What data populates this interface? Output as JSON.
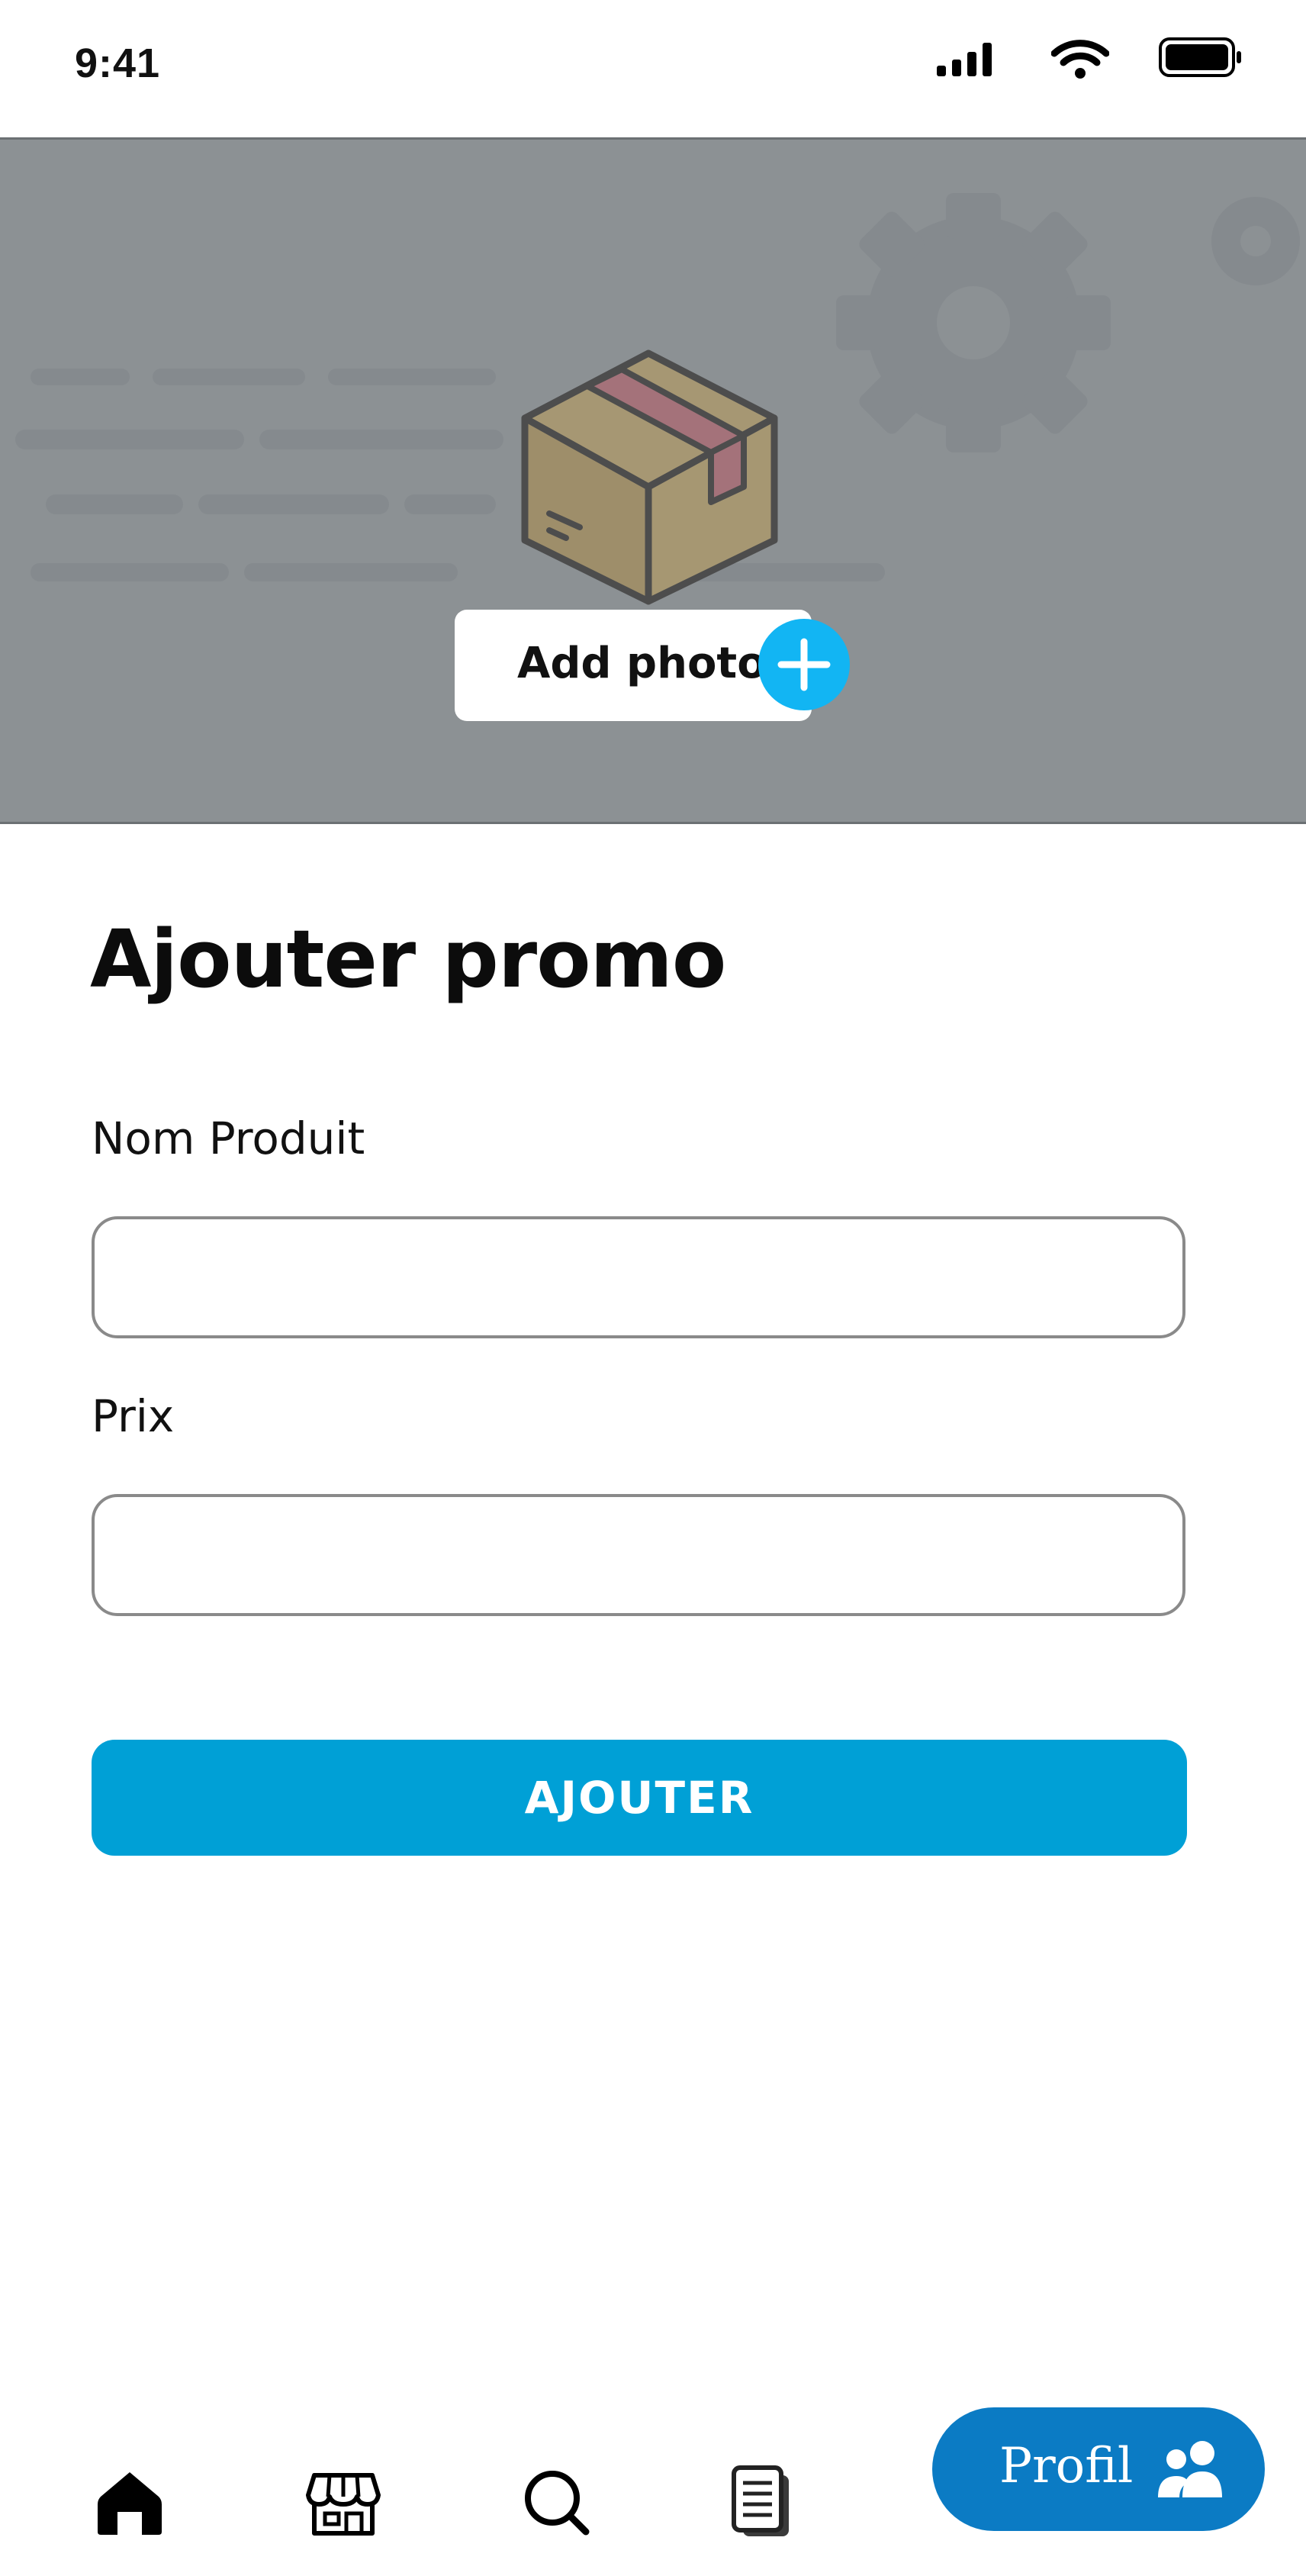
{
  "status_bar": {
    "time": "9:41",
    "icons": [
      "signal-icon",
      "wifi-icon",
      "battery-icon"
    ]
  },
  "hero": {
    "illustration": "package-box-icon",
    "add_photo_label": "Add photo",
    "add_icon": "plus-icon"
  },
  "form": {
    "title": "Ajouter promo",
    "fields": [
      {
        "label": "Nom Produit",
        "value": "",
        "placeholder": ""
      },
      {
        "label": "Prix",
        "value": "",
        "placeholder": ""
      }
    ],
    "submit_label": "AJOUTER"
  },
  "bottom_nav": {
    "items": [
      {
        "icon": "home-icon",
        "active": true
      },
      {
        "icon": "store-icon",
        "active": false
      },
      {
        "icon": "search-icon",
        "active": false
      },
      {
        "icon": "documents-icon",
        "active": false
      }
    ],
    "profile": {
      "label": "Profil",
      "icon": "users-icon"
    }
  },
  "colors": {
    "accent": "#00a0d6",
    "plus_button": "#12b5f3",
    "profile_pill": "#0b7bc4",
    "hero_overlay": "#8c9194"
  }
}
